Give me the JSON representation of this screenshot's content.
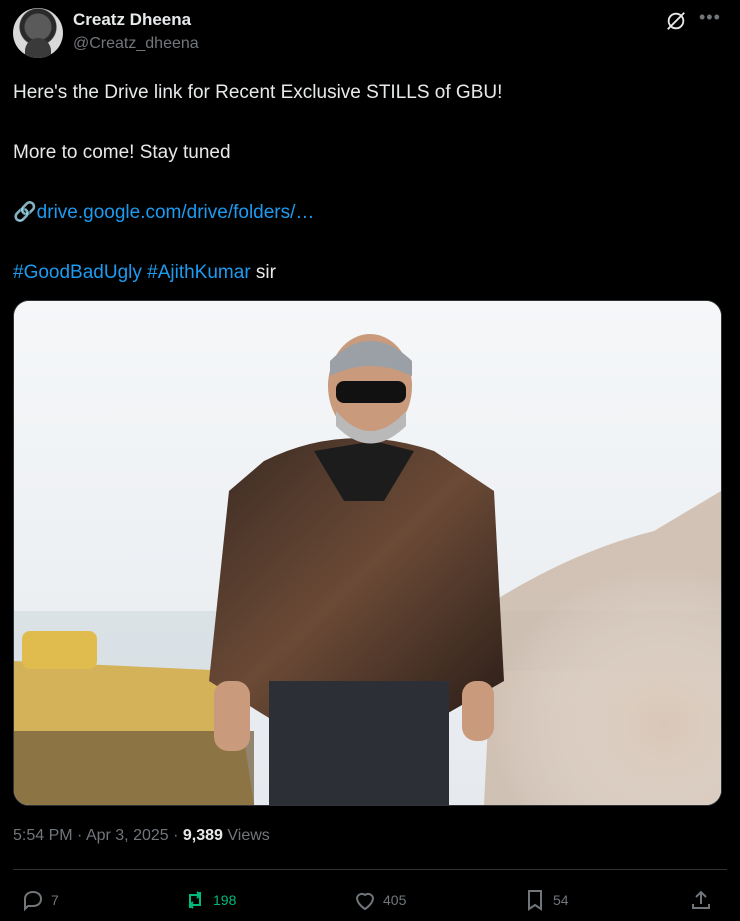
{
  "author": {
    "name": "Creatz Dheena",
    "handle": "@Creatz_dheena"
  },
  "post": {
    "line1": "Here's the Drive link for Recent Exclusive STILLS of GBU!",
    "line2": "More to come! Stay tuned",
    "link_emoji": "🔗",
    "link_text": "drive.google.com/drive/folders/…",
    "hashtag1": "#GoodBadUgly",
    "hashtag2": "#AjithKumar",
    "trailing": " sir"
  },
  "meta": {
    "time": "5:54 PM",
    "sep1": " · ",
    "date": "Apr 3, 2025",
    "sep2": " · ",
    "views_count": "9,389",
    "views_label": " Views"
  },
  "actions": {
    "replies": "7",
    "reposts": "198",
    "likes": "405",
    "bookmarks": "54"
  },
  "colors": {
    "background": "#000000",
    "text": "#e7e9ea",
    "secondary": "#71767b",
    "link": "#1d9bf0",
    "repost_active": "#00ba7c"
  }
}
